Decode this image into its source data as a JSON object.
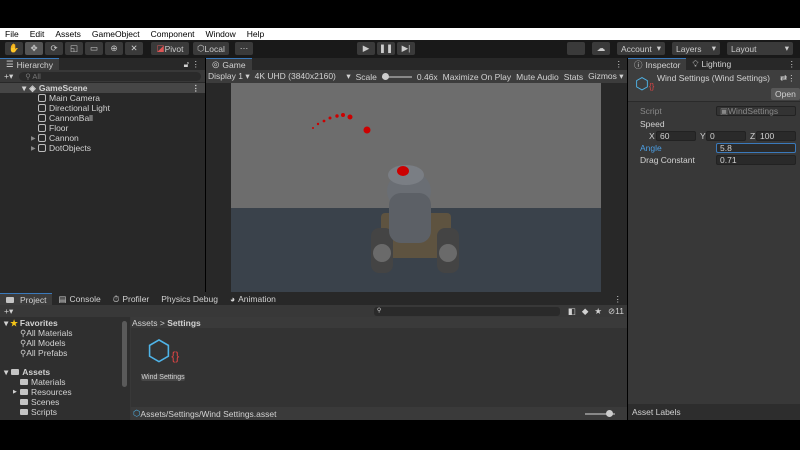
{
  "menu": [
    "File",
    "Edit",
    "Assets",
    "GameObject",
    "Component",
    "Window",
    "Help"
  ],
  "toolbar": {
    "pivot": "Pivot",
    "local": "Local",
    "account": "Account",
    "layers": "Layers",
    "layout": "Layout"
  },
  "hierarchy": {
    "title": "Hierarchy",
    "search_placeholder": "All",
    "scene": "GameScene",
    "items": [
      {
        "label": "Main Camera",
        "expandable": false
      },
      {
        "label": "Directional Light",
        "expandable": false
      },
      {
        "label": "CannonBall",
        "expandable": false
      },
      {
        "label": "Floor",
        "expandable": false
      },
      {
        "label": "Cannon",
        "expandable": true
      },
      {
        "label": "DotObjects",
        "expandable": true
      }
    ]
  },
  "game": {
    "title": "Game",
    "display": "Display 1",
    "resolution": "4K UHD (3840x2160)",
    "scale_label": "Scale",
    "scale_value": "0.46x",
    "maximize": "Maximize On Play",
    "mute": "Mute Audio",
    "stats": "Stats",
    "gizmos": "Gizmos"
  },
  "inspector": {
    "tab": "Inspector",
    "lighting_tab": "Lighting",
    "object_title": "Wind Settings (Wind Settings)",
    "open": "Open",
    "script_label": "Script",
    "script_value": "WindSettings",
    "speed_label": "Speed",
    "x_label": "X",
    "x": "60",
    "y_label": "Y",
    "y": "0",
    "z_label": "Z",
    "z": "100",
    "angle_label": "Angle",
    "angle": "5.8",
    "drag_label": "Drag Constant",
    "drag": "0.71",
    "asset_labels": "Asset Labels"
  },
  "bottom_tabs": [
    "Project",
    "Console",
    "Profiler",
    "Physics Debug",
    "Animation"
  ],
  "project": {
    "favorites": "Favorites",
    "fav_items": [
      "All Materials",
      "All Models",
      "All Prefabs"
    ],
    "assets": "Assets",
    "folders": [
      "Materials",
      "Resources",
      "Scenes",
      "Scripts"
    ],
    "breadcrumb": [
      "Assets",
      "Settings"
    ],
    "asset_name": "Wind Settings",
    "path": "Assets/Settings/Wind Settings.asset",
    "hidden_count": "11"
  },
  "colors": {
    "accent": "#3a79bb",
    "link": "#4c9ee3"
  }
}
